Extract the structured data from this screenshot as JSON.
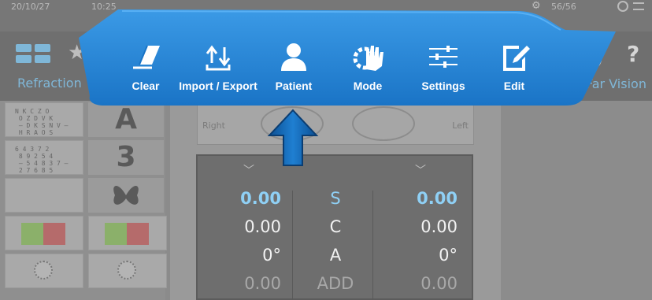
{
  "status": {
    "date": "20/10/27",
    "time": "10:25",
    "counter": "56/56"
  },
  "tabs": {
    "refraction": "Refraction",
    "far_vision": "Far Vision",
    "help": "?"
  },
  "toolbar": {
    "items": [
      {
        "label": "Clear",
        "icon": "eraser-icon"
      },
      {
        "label": "Import / Export",
        "icon": "import-export-icon"
      },
      {
        "label": "Patient",
        "icon": "patient-icon"
      },
      {
        "label": "Mode",
        "icon": "mode-hand-gear-icon"
      },
      {
        "label": "Settings",
        "icon": "sliders-icon"
      },
      {
        "label": "Edit",
        "icon": "edit-icon"
      }
    ],
    "accent": "#1f7fd1"
  },
  "eyes": {
    "right": "Right",
    "left": "Left"
  },
  "charts": {
    "tile1": "N K C Z O\n O Z D V K\n — D K S N V —\n H R A O S",
    "tile2": "6 4 3 7 2\n 8 9 2 5 4\n — 5 4 8 3 7 —\n 2 7 6 8 5",
    "glyph_a": "A",
    "glyph_3": "3"
  },
  "values": {
    "rows": [
      {
        "left": "0.00",
        "mid": "S",
        "right": "0.00",
        "highlight": true
      },
      {
        "left": "0.00",
        "mid": "C",
        "right": "0.00",
        "highlight": false
      },
      {
        "left": "0°",
        "mid": "A",
        "right": "0°",
        "highlight": false
      },
      {
        "left": "0.00",
        "mid": "ADD",
        "right": "0.00",
        "highlight": false
      }
    ]
  }
}
